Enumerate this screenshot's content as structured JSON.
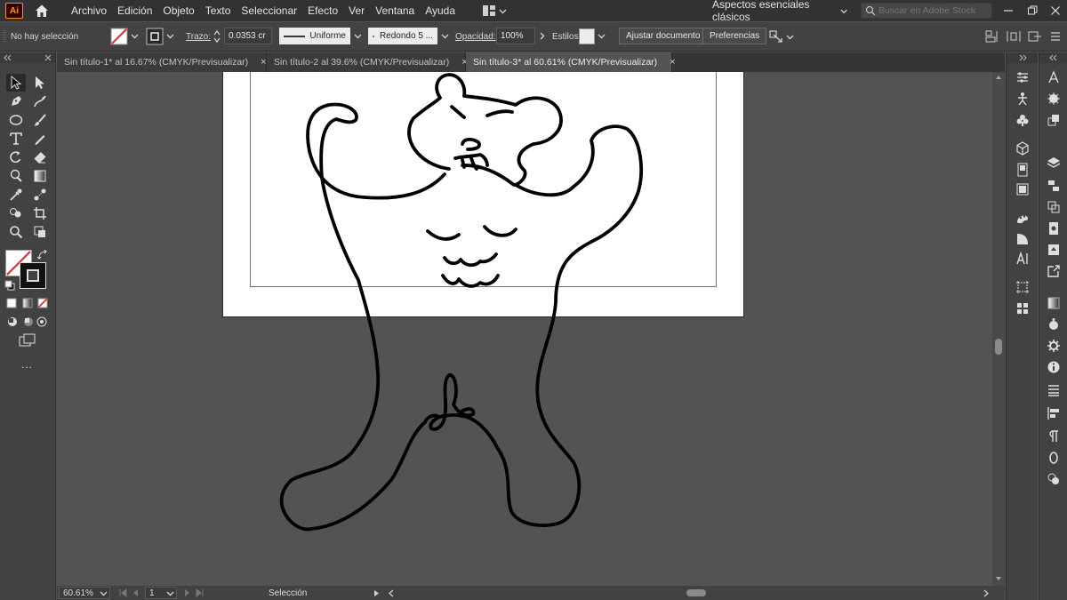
{
  "app": {
    "logo": "Ai",
    "accent": "#ff9a00"
  },
  "menu": {
    "items": [
      "Archivo",
      "Edición",
      "Objeto",
      "Texto",
      "Seleccionar",
      "Efecto",
      "Ver",
      "Ventana",
      "Ayuda"
    ],
    "workspace": "Aspectos esenciales clásicos",
    "search_placeholder": "Buscar en Adobe Stock"
  },
  "control_bar": {
    "selection_status": "No hay selección",
    "stroke_label": "Trazo:",
    "stroke_weight": "0.0353 cr",
    "stroke_profile": "Uniforme",
    "brush": "Redondo 5 ...",
    "opacity_label": "Opacidad:",
    "opacity_value": "100%",
    "style_label": "Estilos:",
    "fit_document_button": "Ajustar documento",
    "preferences_button": "Preferencias"
  },
  "tabs": [
    {
      "label": "Sin título-1* al 16.67% (CMYK/Previsualizar)",
      "active": false
    },
    {
      "label": "Sin título-2 al 39.6% (CMYK/Previsualizar)",
      "active": false
    },
    {
      "label": "Sin título-3* al 60.61% (CMYK/Previsualizar)",
      "active": true
    }
  ],
  "tab_close": "×",
  "status_bar": {
    "zoom": "60.61%",
    "artboard": "1",
    "tool_status": "Selección"
  },
  "tools_more": "..."
}
